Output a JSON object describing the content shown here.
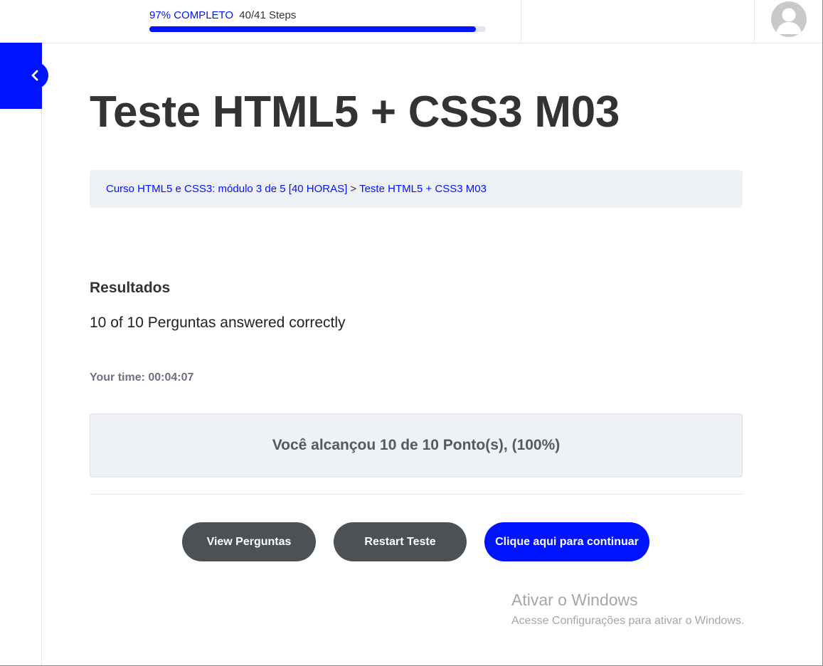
{
  "header": {
    "progress_percent_label": "97% COMPLETO",
    "progress_steps_label": "40/41 Steps",
    "progress_fraction": 0.97
  },
  "page": {
    "title": "Teste HTML5 + CSS3 M03"
  },
  "breadcrumb": {
    "items": [
      "Curso HTML5 e CSS3: módulo 3 de 5 [40 HORAS]",
      "Teste HTML5 + CSS3 M03"
    ],
    "separator": ">"
  },
  "results": {
    "heading": "Resultados",
    "score_text": "10 of 10 Perguntas answered correctly",
    "time_text": "Your time: 00:04:07",
    "points_text": "Você alcançou 10 de 10 Ponto(s), (100%)"
  },
  "actions": {
    "view_label": "View Perguntas",
    "restart_label": "Restart Teste",
    "continue_label": "Clique aqui para continuar"
  },
  "watermark": {
    "title": "Ativar o Windows",
    "subtitle": "Acesse Configurações para ativar o Windows."
  },
  "colors": {
    "accent": "#0013ff",
    "button_dark": "#4b5154",
    "panel_bg": "#eef1f5"
  },
  "icons": {
    "sidebar_toggle": "chevron-left-icon",
    "avatar": "user-avatar-icon"
  }
}
